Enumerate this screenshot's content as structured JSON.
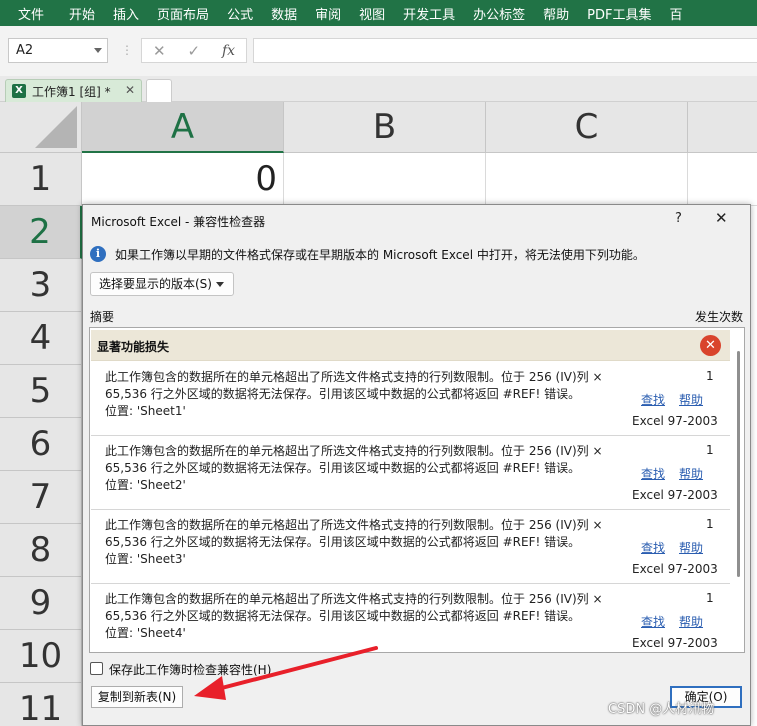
{
  "ribbon": {
    "tabs": [
      "文件",
      "开始",
      "插入",
      "页面布局",
      "公式",
      "数据",
      "审阅",
      "视图",
      "开发工具",
      "办公标签",
      "帮助",
      "PDF工具集",
      "百"
    ]
  },
  "formula_bar": {
    "name_box": "A2",
    "cancel": "✕",
    "enter": "✓",
    "fx": "fx",
    "formula": ""
  },
  "workbook_tab": {
    "name": "工作簿1  [组] *",
    "close": "✕"
  },
  "grid": {
    "columns": [
      "A",
      "B",
      "C"
    ],
    "rows": [
      "1",
      "2",
      "3",
      "4",
      "5",
      "6",
      "7",
      "8",
      "9",
      "10",
      "11"
    ],
    "selected_column": "A",
    "selected_row": "2",
    "cell_a1": "0"
  },
  "dialog": {
    "title": "Microsoft Excel - 兼容性检查器",
    "help": "?",
    "close": "✕",
    "info_text": "如果工作簿以早期的文件格式保存或在早期版本的 Microsoft Excel 中打开，将无法使用下列功能。",
    "version_button": "选择要显示的版本(S)",
    "summary_label": "摘要",
    "count_label": "发生次数",
    "section_title": "显著功能损失",
    "issues": [
      {
        "line1": "此工作簿包含的数据所在的单元格超出了所选文件格式支持的行列数限制。位于 256 (IV)列 ×",
        "line2": "65,536 行之外区域的数据将无法保存。引用该区域中数据的公式都将返回 #REF! 错误。",
        "line3": "位置: 'Sheet1'",
        "count": "1",
        "find": "查找",
        "help": "帮助",
        "version": "Excel 97-2003"
      },
      {
        "line1": "此工作簿包含的数据所在的单元格超出了所选文件格式支持的行列数限制。位于 256 (IV)列 ×",
        "line2": "65,536 行之外区域的数据将无法保存。引用该区域中数据的公式都将返回 #REF! 错误。",
        "line3": "位置: 'Sheet2'",
        "count": "1",
        "find": "查找",
        "help": "帮助",
        "version": "Excel 97-2003"
      },
      {
        "line1": "此工作簿包含的数据所在的单元格超出了所选文件格式支持的行列数限制。位于 256 (IV)列 ×",
        "line2": "65,536 行之外区域的数据将无法保存。引用该区域中数据的公式都将返回 #REF! 错误。",
        "line3": "位置: 'Sheet3'",
        "count": "1",
        "find": "查找",
        "help": "帮助",
        "version": "Excel 97-2003"
      },
      {
        "line1": "此工作簿包含的数据所在的单元格超出了所选文件格式支持的行列数限制。位于 256 (IV)列 ×",
        "line2": "65,536 行之外区域的数据将无法保存。引用该区域中数据的公式都将返回 #REF! 错误。",
        "line3": "位置: 'Sheet4'",
        "count": "1",
        "find": "查找",
        "help": "帮助",
        "version": "Excel 97-2003"
      }
    ],
    "check_on_save_label": "保存此工作簿时检查兼容性(H)",
    "check_on_save_checked": false,
    "copy_button": "复制到新表(N)",
    "ok_button": "确定(O)"
  },
  "watermark": "CSDN @人材汛物",
  "colors": {
    "ribbon": "#217346",
    "accent": "#1e7145",
    "link": "#2a5db0",
    "error": "#d9442c",
    "annotation": "#e8202a"
  }
}
